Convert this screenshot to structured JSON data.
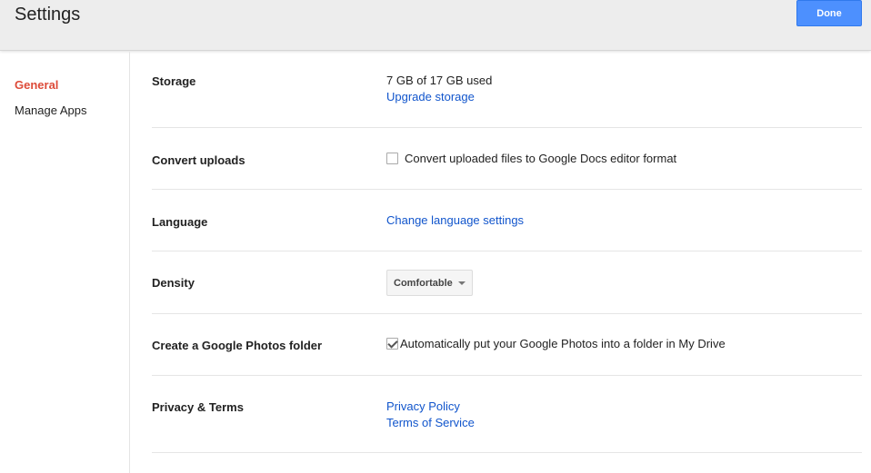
{
  "header": {
    "title": "Settings",
    "done_label": "Done"
  },
  "sidebar": {
    "items": [
      {
        "label": "General",
        "active": true
      },
      {
        "label": "Manage Apps",
        "active": false
      }
    ]
  },
  "settings": {
    "storage": {
      "label": "Storage",
      "usage": "7 GB of 17 GB used",
      "upgrade_link": "Upgrade storage"
    },
    "convert": {
      "label": "Convert uploads",
      "checkbox_label": "Convert uploaded files to Google Docs editor format",
      "checked": false
    },
    "language": {
      "label": "Language",
      "link": "Change language settings"
    },
    "density": {
      "label": "Density",
      "selected": "Comfortable"
    },
    "photos": {
      "label": "Create a Google Photos folder",
      "checkbox_label": "Automatically put your Google Photos into a folder in My Drive",
      "checked": true
    },
    "privacy": {
      "label": "Privacy & Terms",
      "privacy_link": "Privacy Policy",
      "terms_link": "Terms of Service"
    }
  },
  "colors": {
    "accent": "#4d90fe",
    "link": "#1155cc",
    "active_nav": "#dd4b39"
  }
}
